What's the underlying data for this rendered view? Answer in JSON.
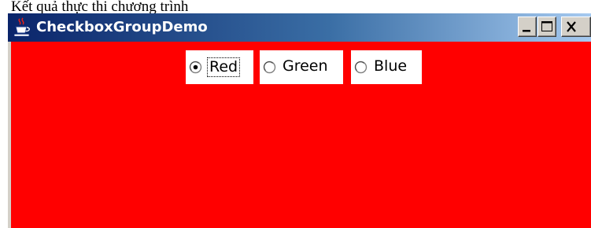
{
  "page_caption": "Kết quả thực thi chương trình",
  "window": {
    "title": "CheckboxGroupDemo",
    "icon": "java-coffee-cup-icon",
    "controls": {
      "minimize_icon": "minimize-icon",
      "maximize_icon": "maximize-icon",
      "close_icon": "close-icon"
    }
  },
  "panel": {
    "background_color": "#ff0000",
    "radio_group": {
      "selected": "Red",
      "focused": "Red",
      "options": [
        {
          "label": "Red",
          "checked": true
        },
        {
          "label": "Green",
          "checked": false
        },
        {
          "label": "Blue",
          "checked": false
        }
      ]
    }
  },
  "colors": {
    "title_bar_start": "#0a246a",
    "title_bar_end": "#a6caf0",
    "window_face": "#d4d0c8",
    "radio_background": "#ffffff"
  }
}
